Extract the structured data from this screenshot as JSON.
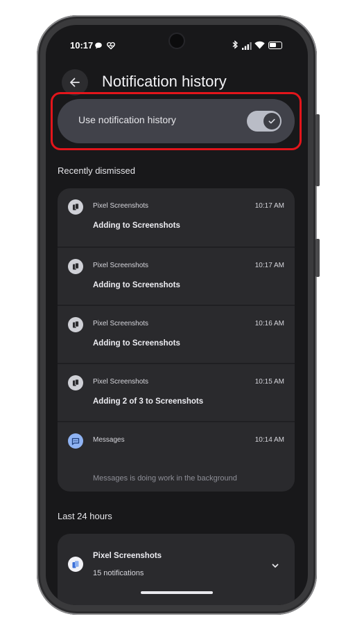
{
  "status_bar": {
    "time": "10:17"
  },
  "header": {
    "title": "Notification history"
  },
  "toggle": {
    "label": "Use notification history",
    "enabled": true
  },
  "sections": {
    "recent": "Recently dismissed",
    "last24": "Last 24 hours"
  },
  "recent_items": [
    {
      "app": "Pixel Screenshots",
      "time": "10:17 AM",
      "text": "Adding to Screenshots",
      "icon": "pixel-screenshots-icon"
    },
    {
      "app": "Pixel Screenshots",
      "time": "10:17 AM",
      "text": "Adding to Screenshots",
      "icon": "pixel-screenshots-icon"
    },
    {
      "app": "Pixel Screenshots",
      "time": "10:16 AM",
      "text": "Adding to Screenshots",
      "icon": "pixel-screenshots-icon"
    },
    {
      "app": "Pixel Screenshots",
      "time": "10:15 AM",
      "text": "Adding 2 of 3 to Screenshots",
      "icon": "pixel-screenshots-icon"
    },
    {
      "app": "Messages",
      "time": "10:14 AM",
      "text": "Messages is doing work in the background",
      "icon": "messages-icon"
    }
  ],
  "last24": {
    "app": "Pixel Screenshots",
    "count": "15 notifications"
  },
  "colors": {
    "highlight": "#e3151b",
    "screen_bg": "#18181a",
    "card_bg": "#2a2a2d",
    "toggle_track": "#b9bcc6"
  }
}
